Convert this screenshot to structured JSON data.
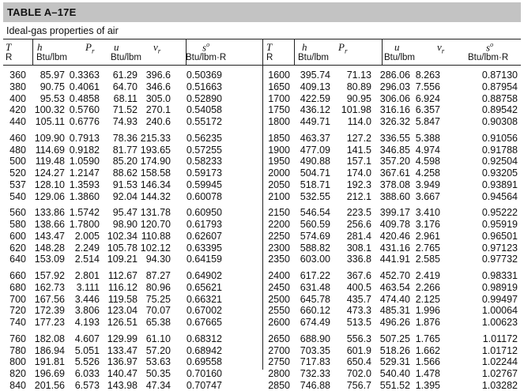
{
  "table": {
    "title": "TABLE A–17E",
    "subtitle": "Ideal-gas properties of air"
  },
  "headers": {
    "T": {
      "sym": "T",
      "unit": "R"
    },
    "h": {
      "sym": "h",
      "unit": "Btu/lbm"
    },
    "Pr": {
      "sym": "P",
      "sub": "r",
      "unit": ""
    },
    "u": {
      "sym": "u",
      "unit": "Btu/lbm"
    },
    "vr": {
      "sym": "v",
      "sub": "r",
      "unit": ""
    },
    "s": {
      "sym": "s",
      "sup": "o",
      "unit": "Btu/lbm·R"
    }
  },
  "left_groups": [
    [
      [
        "360",
        "85.97",
        "0.3363",
        "61.29",
        "396.6",
        "0.50369"
      ],
      [
        "380",
        "90.75",
        "0.4061",
        "64.70",
        "346.6",
        "0.51663"
      ],
      [
        "400",
        "95.53",
        "0.4858",
        "68.11",
        "305.0",
        "0.52890"
      ],
      [
        "420",
        "100.32",
        "0.5760",
        "71.52",
        "270.1",
        "0.54058"
      ],
      [
        "440",
        "105.11",
        "0.6776",
        "74.93",
        "240.6",
        "0.55172"
      ]
    ],
    [
      [
        "460",
        "109.90",
        "0.7913",
        "78.36",
        "215.33",
        "0.56235"
      ],
      [
        "480",
        "114.69",
        "0.9182",
        "81.77",
        "193.65",
        "0.57255"
      ],
      [
        "500",
        "119.48",
        "1.0590",
        "85.20",
        "174.90",
        "0.58233"
      ],
      [
        "520",
        "124.27",
        "1.2147",
        "88.62",
        "158.58",
        "0.59173"
      ],
      [
        "537",
        "128.10",
        "1.3593",
        "91.53",
        "146.34",
        "0.59945"
      ],
      [
        "540",
        "129.06",
        "1.3860",
        "92.04",
        "144.32",
        "0.60078"
      ]
    ],
    [
      [
        "560",
        "133.86",
        "1.5742",
        "95.47",
        "131.78",
        "0.60950"
      ],
      [
        "580",
        "138.66",
        "1.7800",
        "98.90",
        "120.70",
        "0.61793"
      ],
      [
        "600",
        "143.47",
        "2.005",
        "102.34",
        "110.88",
        "0.62607"
      ],
      [
        "620",
        "148.28",
        "2.249",
        "105.78",
        "102.12",
        "0.63395"
      ],
      [
        "640",
        "153.09",
        "2.514",
        "109.21",
        "94.30",
        "0.64159"
      ]
    ],
    [
      [
        "660",
        "157.92",
        "2.801",
        "112.67",
        "87.27",
        "0.64902"
      ],
      [
        "680",
        "162.73",
        "3.111",
        "116.12",
        "80.96",
        "0.65621"
      ],
      [
        "700",
        "167.56",
        "3.446",
        "119.58",
        "75.25",
        "0.66321"
      ],
      [
        "720",
        "172.39",
        "3.806",
        "123.04",
        "70.07",
        "0.67002"
      ],
      [
        "740",
        "177.23",
        "4.193",
        "126.51",
        "65.38",
        "0.67665"
      ]
    ],
    [
      [
        "760",
        "182.08",
        "4.607",
        "129.99",
        "61.10",
        "0.68312"
      ],
      [
        "780",
        "186.94",
        "5.051",
        "133.47",
        "57.20",
        "0.68942"
      ],
      [
        "800",
        "191.81",
        "5.526",
        "136.97",
        "53.63",
        "0.69558"
      ],
      [
        "820",
        "196.69",
        "6.033",
        "140.47",
        "50.35",
        "0.70160"
      ],
      [
        "840",
        "201.56",
        "6.573",
        "143.98",
        "47.34",
        "0.70747"
      ]
    ]
  ],
  "right_groups": [
    [
      [
        "1600",
        "395.74",
        "71.13",
        "286.06",
        "8.263",
        "0.87130"
      ],
      [
        "1650",
        "409.13",
        "80.89",
        "296.03",
        "7.556",
        "0.87954"
      ],
      [
        "1700",
        "422.59",
        "90.95",
        "306.06",
        "6.924",
        "0.88758"
      ],
      [
        "1750",
        "436.12",
        "101.98",
        "316.16",
        "6.357",
        "0.89542"
      ],
      [
        "1800",
        "449.71",
        "114.0",
        "326.32",
        "5.847",
        "0.90308"
      ]
    ],
    [
      [
        "1850",
        "463.37",
        "127.2",
        "336.55",
        "5.388",
        "0.91056"
      ],
      [
        "1900",
        "477.09",
        "141.5",
        "346.85",
        "4.974",
        "0.91788"
      ],
      [
        "1950",
        "490.88",
        "157.1",
        "357.20",
        "4.598",
        "0.92504"
      ],
      [
        "2000",
        "504.71",
        "174.0",
        "367.61",
        "4.258",
        "0.93205"
      ],
      [
        "2050",
        "518.71",
        "192.3",
        "378.08",
        "3.949",
        "0.93891"
      ],
      [
        "2100",
        "532.55",
        "212.1",
        "388.60",
        "3.667",
        "0.94564"
      ]
    ],
    [
      [
        "2150",
        "546.54",
        "223.5",
        "399.17",
        "3.410",
        "0.95222"
      ],
      [
        "2200",
        "560.59",
        "256.6",
        "409.78",
        "3.176",
        "0.95919"
      ],
      [
        "2250",
        "574.69",
        "281.4",
        "420.46",
        "2.961",
        "0.96501"
      ],
      [
        "2300",
        "588.82",
        "308.1",
        "431.16",
        "2.765",
        "0.97123"
      ],
      [
        "2350",
        "603.00",
        "336.8",
        "441.91",
        "2.585",
        "0.97732"
      ]
    ],
    [
      [
        "2400",
        "617.22",
        "367.6",
        "452.70",
        "2.419",
        "0.98331"
      ],
      [
        "2450",
        "631.48",
        "400.5",
        "463.54",
        "2.266",
        "0.98919"
      ],
      [
        "2500",
        "645.78",
        "435.7",
        "474.40",
        "2.125",
        "0.99497"
      ],
      [
        "2550",
        "660.12",
        "473.3",
        "485.31",
        "1.996",
        "1.00064"
      ],
      [
        "2600",
        "674.49",
        "513.5",
        "496.26",
        "1.876",
        "1.00623"
      ]
    ],
    [
      [
        "2650",
        "688.90",
        "556.3",
        "507.25",
        "1.765",
        "1.01172"
      ],
      [
        "2700",
        "703.35",
        "601.9",
        "518.26",
        "1.662",
        "1.01712"
      ],
      [
        "2750",
        "717.83",
        "650.4",
        "529.31",
        "1.566",
        "1.02244"
      ],
      [
        "2800",
        "732.33",
        "702.0",
        "540.40",
        "1.478",
        "1.02767"
      ],
      [
        "2850",
        "746.88",
        "756.7",
        "551.52",
        "1.395",
        "1.03282"
      ]
    ]
  ]
}
